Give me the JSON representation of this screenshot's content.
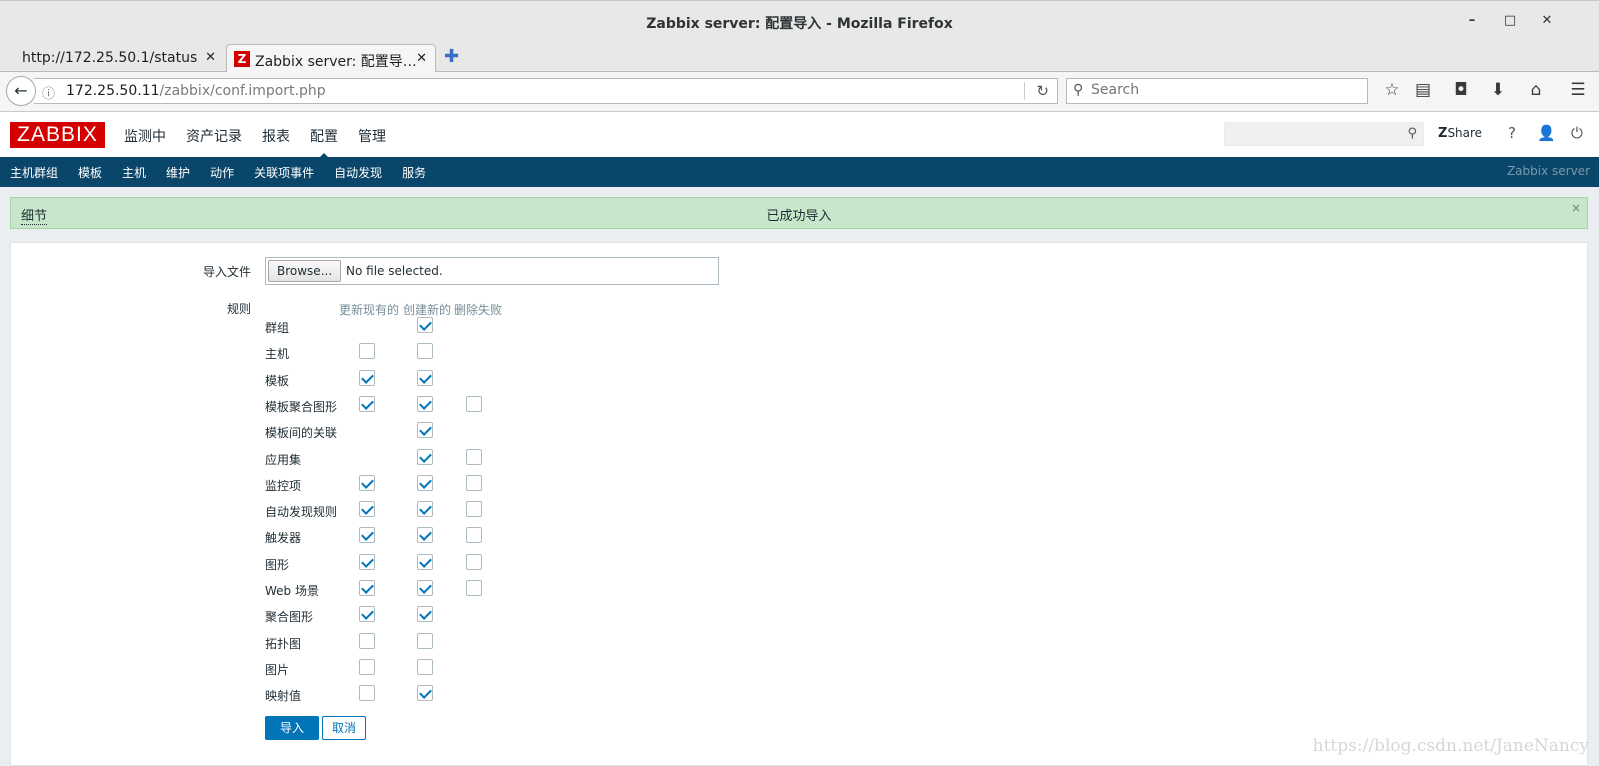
{
  "window": {
    "title": "Zabbix server: 配置导入 - Mozilla Firefox",
    "minimize": "–",
    "maximize": "□",
    "close": "✕"
  },
  "tabs": [
    {
      "label": "http://172.25.50.1/status",
      "close": "✕"
    },
    {
      "label": "Zabbix server: 配置导…",
      "close": "✕",
      "favicon": "Z"
    }
  ],
  "new_tab": "✚",
  "address": {
    "host": "172.25.50.11",
    "path": "/zabbix/conf.import.php",
    "search_placeholder": "Search"
  },
  "zabbix": {
    "logo": "ZABBIX",
    "menu": [
      "监测中",
      "资产记录",
      "报表",
      "配置",
      "管理"
    ],
    "selected_menu": "配置",
    "share": "Share",
    "share_mark": "Z",
    "help": "?",
    "submenu": [
      "主机群组",
      "模板",
      "主机",
      "维护",
      "动作",
      "关联项事件",
      "自动发现",
      "服务"
    ],
    "server_name": "Zabbix server"
  },
  "message": {
    "details": "细节",
    "text": "已成功导入",
    "close": "×"
  },
  "form": {
    "import_file_label": "导入文件",
    "browse_label": "Browse...",
    "no_file": "No file selected.",
    "rules_label": "规则",
    "col_update": "更新现有的",
    "col_create": "创建新的",
    "col_delete": "删除失败",
    "rules": [
      {
        "name": "群组",
        "update": null,
        "create": true,
        "delete": null
      },
      {
        "name": "主机",
        "update": false,
        "create": false,
        "delete": null
      },
      {
        "name": "模板",
        "update": true,
        "create": true,
        "delete": null
      },
      {
        "name": "模板聚合图形",
        "update": true,
        "create": true,
        "delete": false
      },
      {
        "name": "模板间的关联",
        "update": null,
        "create": true,
        "delete": null
      },
      {
        "name": "应用集",
        "update": null,
        "create": true,
        "delete": false
      },
      {
        "name": "监控项",
        "update": true,
        "create": true,
        "delete": false
      },
      {
        "name": "自动发现规则",
        "update": true,
        "create": true,
        "delete": false
      },
      {
        "name": "触发器",
        "update": true,
        "create": true,
        "delete": false
      },
      {
        "name": "图形",
        "update": true,
        "create": true,
        "delete": false
      },
      {
        "name": "Web 场景",
        "update": true,
        "create": true,
        "delete": false
      },
      {
        "name": "聚合图形",
        "update": true,
        "create": true,
        "delete": null
      },
      {
        "name": "拓扑图",
        "update": false,
        "create": false,
        "delete": null
      },
      {
        "name": "图片",
        "update": false,
        "create": false,
        "delete": null
      },
      {
        "name": "映射值",
        "update": false,
        "create": true,
        "delete": null
      }
    ],
    "import_button": "导入",
    "cancel_button": "取消"
  },
  "watermark": "https://blog.csdn.net/JaneNancy",
  "colors": {
    "brand_red": "#d40000",
    "nav_blue": "#0a466a",
    "accent_blue": "#0275b8",
    "success_bg": "#c8e6c9"
  }
}
